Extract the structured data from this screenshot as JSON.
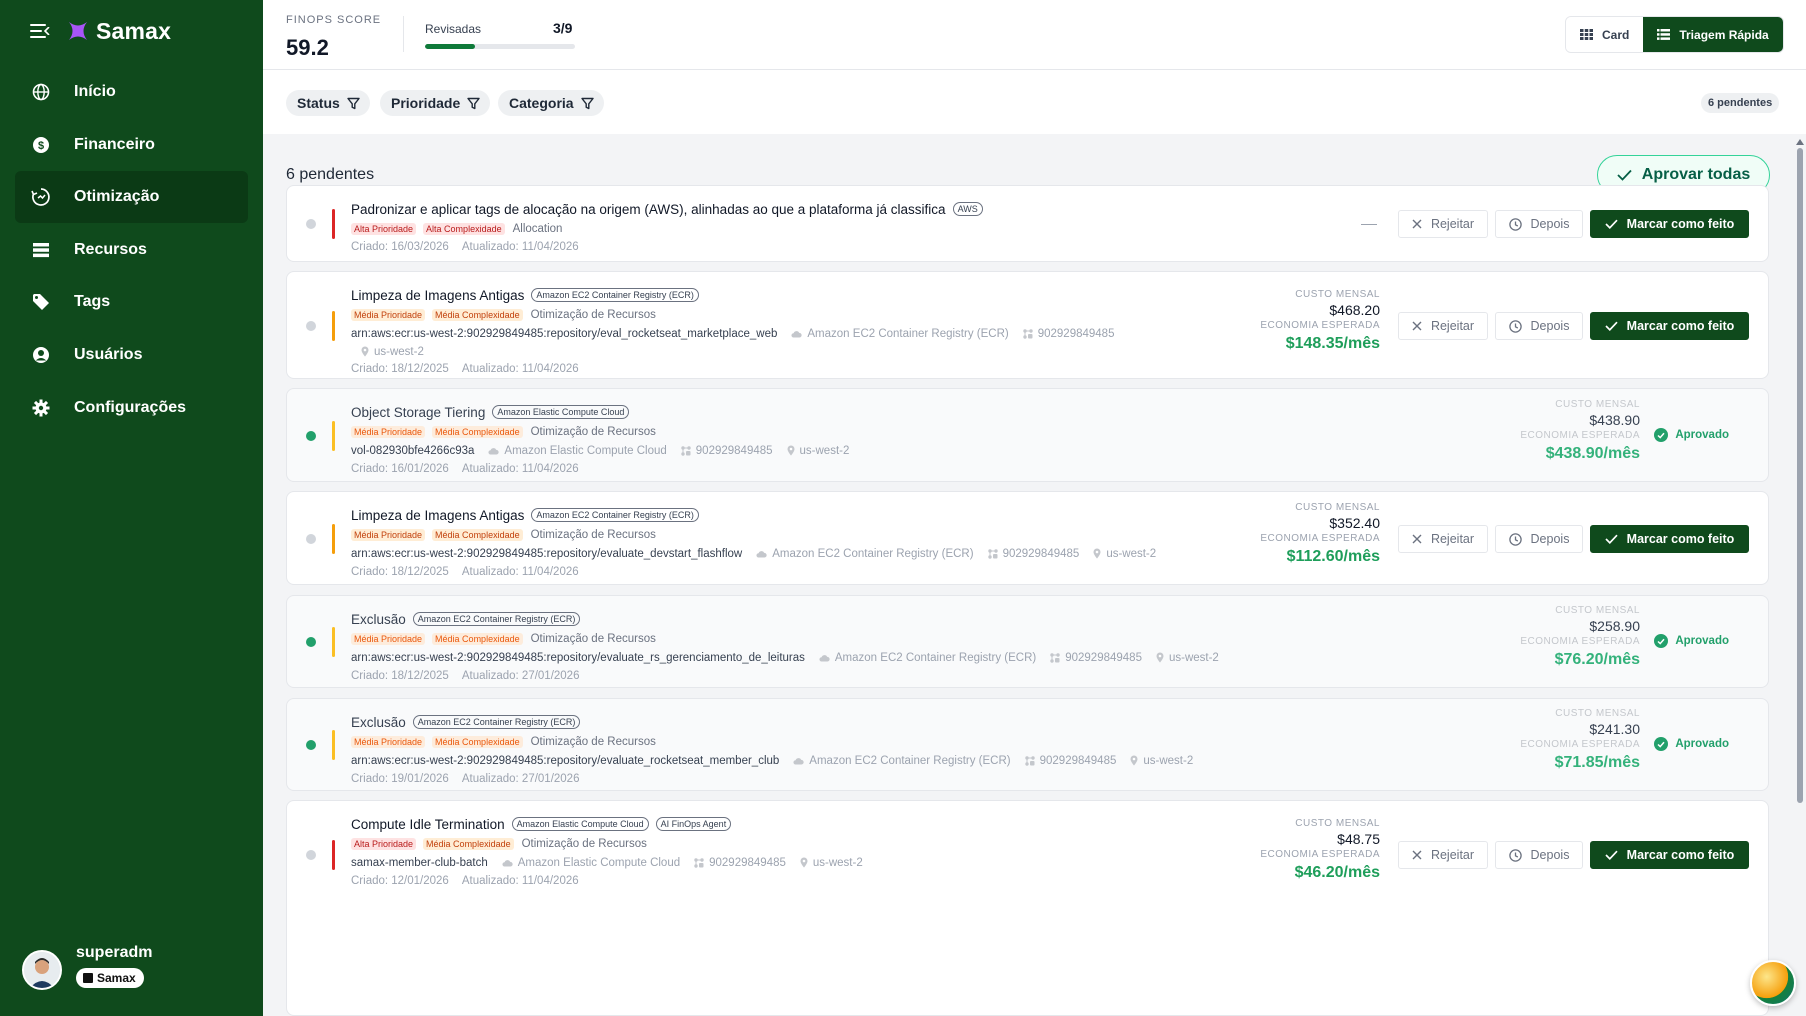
{
  "app": {
    "name": "Samax"
  },
  "sidebar": {
    "items": [
      {
        "label": "Início",
        "icon": "globe-icon",
        "active": false
      },
      {
        "label": "Financeiro",
        "icon": "dollar-icon",
        "active": false
      },
      {
        "label": "Otimização",
        "icon": "optimize-icon",
        "active": true
      },
      {
        "label": "Recursos",
        "icon": "list-icon",
        "active": false
      },
      {
        "label": "Tags",
        "icon": "tag-icon",
        "active": false
      },
      {
        "label": "Usuários",
        "icon": "user-icon",
        "active": false
      },
      {
        "label": "Configurações",
        "icon": "gear-icon",
        "active": false
      }
    ],
    "user": {
      "name": "superadm",
      "org": "Samax"
    }
  },
  "header": {
    "score_label": "FINOPS SCORE",
    "score_value": "59.2",
    "reviewed_label": "Revisadas",
    "reviewed_count": "3/9",
    "reviewed_progress": 0.33,
    "view_card": "Card",
    "view_triage": "Triagem Rápida"
  },
  "filters": {
    "status": "Status",
    "priority": "Prioridade",
    "category": "Categoria",
    "pending_badge": "6 pendentes"
  },
  "main": {
    "count_title": "6 pendentes",
    "approve_all": "Aprovar todas",
    "labels": {
      "monthly_cost": "CUSTO MENSAL",
      "expected_savings": "ECONOMIA ESPERADA",
      "reject": "Rejeitar",
      "later": "Depois",
      "mark_done": "Marcar como feito",
      "approved": "Aprovado"
    }
  },
  "cards": [
    {
      "title": "Padronizar e aplicar tags de alocação na origem (AWS), alinhadas ao que a plataforma já classifica",
      "tags": [
        "AWS"
      ],
      "priority": "Alta Prioridade",
      "complexity": "Alta Complexidade",
      "category": "Allocation",
      "created": "Criado: 16/03/2026",
      "updated": "Atualizado: 11/04/2026",
      "status": "pending",
      "accent": "#dc2626"
    },
    {
      "title": "Limpeza de Imagens Antigas",
      "tags": [
        "Amazon EC2 Container Registry (ECR)"
      ],
      "priority": "Média Prioridade",
      "complexity": "Média Complexidade",
      "category": "Otimização de Recursos",
      "arn": "arn:aws:ecr:us-west-2:902929849485:repository/eval_rocketseat_marketplace_web",
      "service": "Amazon EC2 Container Registry (ECR)",
      "account": "902929849485",
      "region": "us-west-2",
      "created": "Criado: 18/12/2025",
      "updated": "Atualizado: 11/04/2026",
      "cost": "$468.20",
      "savings": "$148.35/mês",
      "status": "pending",
      "accent": "#f59e0b"
    },
    {
      "title": "Object Storage Tiering",
      "tags": [
        "Amazon Elastic Compute Cloud"
      ],
      "priority": "Média Prioridade",
      "complexity": "Média Complexidade",
      "category": "Otimização de Recursos",
      "arn": "vol-082930bfe4266c93a",
      "service": "Amazon Elastic Compute Cloud",
      "account": "902929849485",
      "region": "us-west-2",
      "created": "Criado: 16/01/2026",
      "updated": "Atualizado: 11/04/2026",
      "cost": "$438.90",
      "savings": "$438.90/mês",
      "status": "approved",
      "accent": "#fbbf24"
    },
    {
      "title": "Limpeza de Imagens Antigas",
      "tags": [
        "Amazon EC2 Container Registry (ECR)"
      ],
      "priority": "Média Prioridade",
      "complexity": "Média Complexidade",
      "category": "Otimização de Recursos",
      "arn": "arn:aws:ecr:us-west-2:902929849485:repository/evaluate_devstart_flashflow",
      "service": "Amazon EC2 Container Registry (ECR)",
      "account": "902929849485",
      "region": "us-west-2",
      "created": "Criado: 18/12/2025",
      "updated": "Atualizado: 11/04/2026",
      "cost": "$352.40",
      "savings": "$112.60/mês",
      "status": "pending",
      "accent": "#f59e0b"
    },
    {
      "title": "Exclusão",
      "tags": [
        "Amazon EC2 Container Registry (ECR)"
      ],
      "priority": "Média Prioridade",
      "complexity": "Média Complexidade",
      "category": "Otimização de Recursos",
      "arn": "arn:aws:ecr:us-west-2:902929849485:repository/evaluate_rs_gerenciamento_de_leituras",
      "service": "Amazon EC2 Container Registry (ECR)",
      "account": "902929849485",
      "region": "us-west-2",
      "created": "Criado: 18/12/2025",
      "updated": "Atualizado: 27/01/2026",
      "cost": "$258.90",
      "savings": "$76.20/mês",
      "status": "approved",
      "accent": "#fbbf24"
    },
    {
      "title": "Exclusão",
      "tags": [
        "Amazon EC2 Container Registry (ECR)"
      ],
      "priority": "Média Prioridade",
      "complexity": "Média Complexidade",
      "category": "Otimização de Recursos",
      "arn": "arn:aws:ecr:us-west-2:902929849485:repository/evaluate_rocketseat_member_club",
      "service": "Amazon EC2 Container Registry (ECR)",
      "account": "902929849485",
      "region": "us-west-2",
      "created": "Criado: 19/01/2026",
      "updated": "Atualizado: 27/01/2026",
      "cost": "$241.30",
      "savings": "$71.85/mês",
      "status": "approved",
      "accent": "#fbbf24"
    },
    {
      "title": "Compute Idle Termination",
      "tags": [
        "Amazon Elastic Compute Cloud",
        "AI FinOps Agent"
      ],
      "priority": "Alta Prioridade",
      "complexity": "Média Complexidade",
      "category": "Otimização de Recursos",
      "arn": "samax-member-club-batch",
      "service": "Amazon Elastic Compute Cloud",
      "account": "902929849485",
      "region": "us-west-2",
      "created": "Criado: 12/01/2026",
      "updated": "Atualizado: 11/04/2026",
      "cost": "$48.75",
      "savings": "$46.20/mês",
      "status": "pending",
      "accent": "#dc2626"
    }
  ]
}
